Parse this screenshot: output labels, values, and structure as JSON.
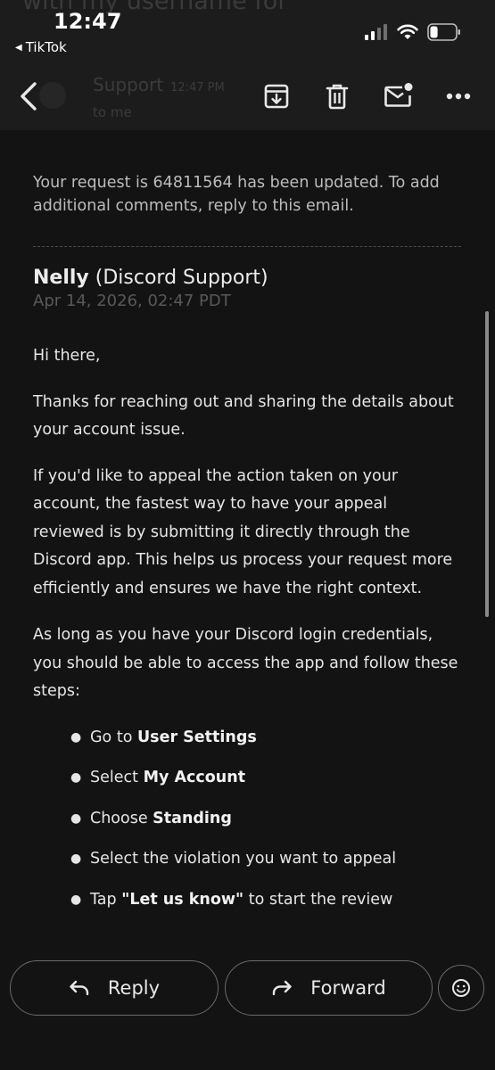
{
  "status_bar": {
    "time": "12:47",
    "back_app": "TikTok",
    "battery_level": 0.3
  },
  "background_header": {
    "subject_fragment": "with my username for",
    "sender": "Support",
    "time": "12:47 PM",
    "recipient": "to me"
  },
  "toolbar": {
    "icons": [
      "back-arrow-icon",
      "archive-icon",
      "trash-icon",
      "mark-unread-icon",
      "more-icon"
    ]
  },
  "email": {
    "intro": "Your request is 64811564 has been updated. To add additional comments, reply to this email.",
    "author_name": "Nelly",
    "author_org": "(Discord Support)",
    "date": "Apr 14, 2026, 02:47 PDT",
    "greeting": "Hi there,",
    "thanks": "Thanks for reaching out and sharing the details about your account issue.",
    "appeal": "If you'd like to appeal the action taken on your account, the fastest way to have your appeal reviewed is by submitting it directly through the Discord app. This helps us process your request more efficiently and ensures we have the right context.",
    "credentials": "As long as you have your Discord login credentials, you should be able to access the app and follow these steps:",
    "steps": [
      {
        "prefix": "Go to ",
        "bold": "User Settings",
        "suffix": ""
      },
      {
        "prefix": "Select ",
        "bold": "My Account",
        "suffix": ""
      },
      {
        "prefix": "Choose ",
        "bold": "Standing",
        "suffix": ""
      },
      {
        "prefix": "Select the violation you want to appeal",
        "bold": "",
        "suffix": ""
      },
      {
        "prefix": "Tap ",
        "bold": "\"Let us know\"",
        "suffix": " to start the review"
      }
    ]
  },
  "actions": {
    "reply_label": "Reply",
    "forward_label": "Forward"
  },
  "colors": {
    "background": "#131313",
    "toolbar": "#1c1c1c",
    "text": "#e6e6e6",
    "muted_text": "#595959",
    "button_border": "#6b6b6b"
  }
}
